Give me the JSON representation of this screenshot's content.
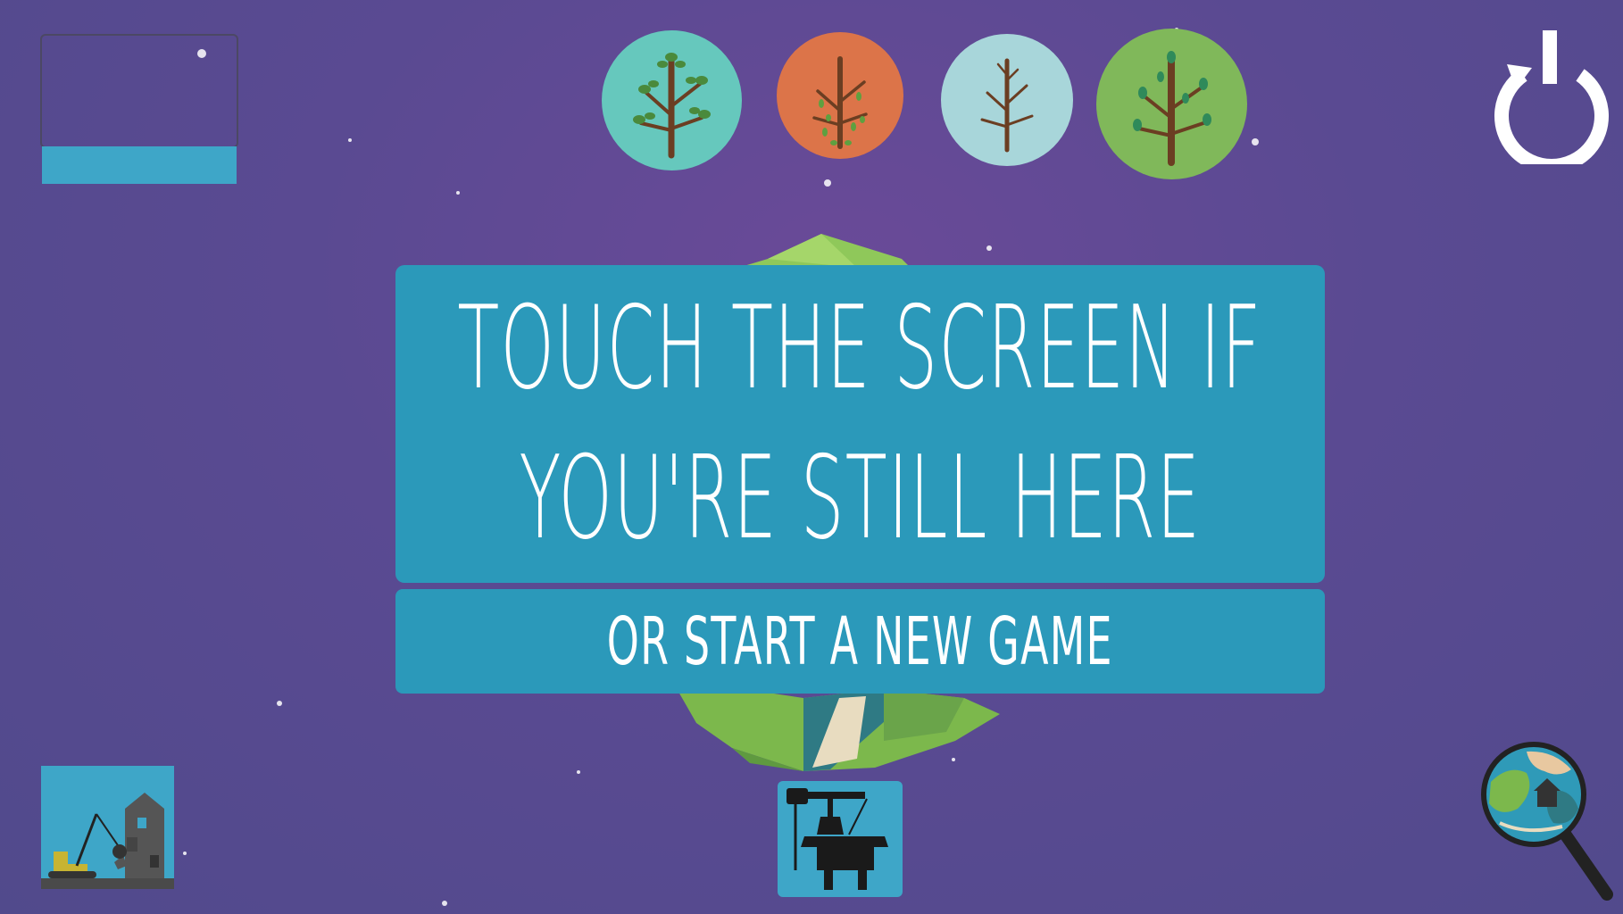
{
  "message": {
    "line1": "Touch the screen if",
    "line2": "you're still here"
  },
  "new_game": {
    "label": "or start a new game"
  },
  "colors": {
    "background": "#5a4a92",
    "panel": "#2b99ba",
    "tool_tile": "#3ea6c8",
    "spring": "#66c8bd",
    "autumn": "#dc7449",
    "winter": "#a8d6da",
    "summer": "#80b85a"
  },
  "seasons": [
    {
      "name": "spring-icon",
      "color": "#66c8bd"
    },
    {
      "name": "autumn-icon",
      "color": "#dc7449"
    },
    {
      "name": "winter-icon",
      "color": "#a8d6da"
    },
    {
      "name": "summer-icon",
      "color": "#80b85a"
    }
  ],
  "icons": {
    "power": "power-icon",
    "demolish": "demolish-icon",
    "oil_rig": "oil-rig-icon",
    "inspect": "magnifier-globe-icon"
  }
}
